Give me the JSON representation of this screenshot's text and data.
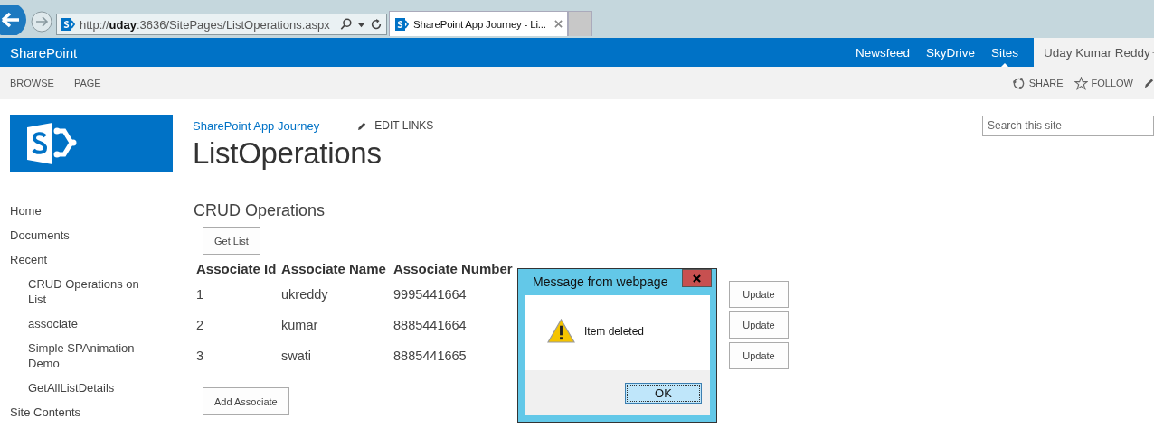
{
  "browser": {
    "address": "http://**uday**:3636/SitePages/ListOperations.aspx",
    "tab_title": "SharePoint App Journey - Li..."
  },
  "suite_bar": {
    "brand": "SharePoint",
    "links": [
      {
        "label": "Newsfeed",
        "selected": false
      },
      {
        "label": "SkyDrive",
        "selected": false
      },
      {
        "label": "Sites",
        "selected": true
      }
    ],
    "user": "Uday Kumar Reddy"
  },
  "ribbon": {
    "tabs": [
      "BROWSE",
      "PAGE"
    ],
    "actions": [
      {
        "kind": "share",
        "label": "SHARE"
      },
      {
        "kind": "follow",
        "label": "FOLLOW"
      }
    ]
  },
  "site": {
    "breadcrumb": "SharePoint App Journey",
    "edit_links": "EDIT LINKS",
    "title": "ListOperations",
    "search": {
      "placeholder": "Search this site"
    }
  },
  "nav": [
    {
      "label": "Home"
    },
    {
      "label": "Documents"
    },
    {
      "label": "Recent",
      "children": [
        {
          "label": "CRUD Operations on List"
        },
        {
          "label": "associate"
        },
        {
          "label": "Simple SPAnimation Demo"
        },
        {
          "label": "GetAllListDetails"
        }
      ]
    },
    {
      "label": "Site Contents"
    }
  ],
  "content": {
    "heading": "CRUD Operations",
    "get_list_button": "Get List",
    "columns": [
      "Associate Id",
      "Associate Name",
      "Associate Number"
    ],
    "rows": [
      {
        "id": "1",
        "name": "ukreddy",
        "number": "9995441664",
        "action": "Update"
      },
      {
        "id": "2",
        "name": "kumar",
        "number": "8885441664",
        "action": "Update"
      },
      {
        "id": "3",
        "name": "swati",
        "number": "8885441665",
        "action": "Update"
      }
    ],
    "add_button": "Add Associate"
  },
  "dialog": {
    "title": "Message from webpage",
    "message": "Item deleted",
    "button": "OK"
  }
}
